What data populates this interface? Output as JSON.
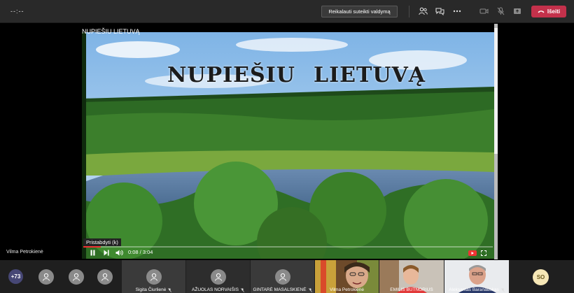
{
  "topbar": {
    "timer": "--:--",
    "request_control_label": "Reikalauti suteikti valdymą",
    "leave_label": "Išeiti",
    "colors": {
      "leave": "#c4314b"
    }
  },
  "presentation": {
    "title": "NUPIEŠIU LIETUVĄ",
    "heading_left": "NUPIEŠIU",
    "heading_right": "LIETUVĄ",
    "presenter_name": "Vilma Petrokienė"
  },
  "video": {
    "pause_tooltip": "Pristabdyti (k)",
    "time_display": "0:08 / 3:04",
    "progress_fraction": 0.043
  },
  "roster": {
    "extra_count": "+73",
    "tiles": [
      {
        "name": "Sigita Čiurlienė",
        "type": "avatar"
      },
      {
        "name": "AŽUOLAS NORVAIŠIS",
        "type": "avatar"
      },
      {
        "name": "GINTARĖ MASALSKIENĖ",
        "type": "avatar"
      },
      {
        "name": "Vilma Petrokienė",
        "type": "video"
      },
      {
        "name": "EMILIS BUTNORIUS",
        "type": "video"
      },
      {
        "name": "Aleksantas Baranauskas",
        "type": "video"
      }
    ],
    "so_initials": "SO"
  }
}
